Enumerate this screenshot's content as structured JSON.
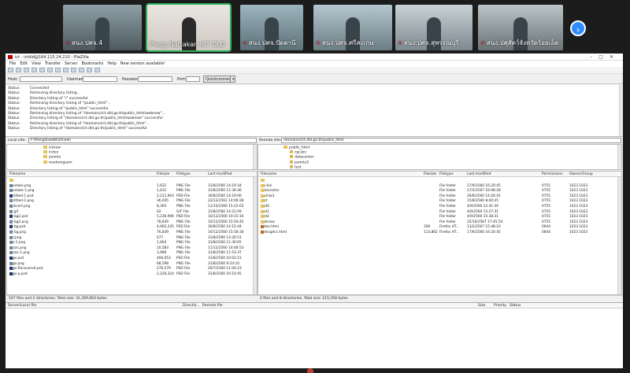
{
  "participants": [
    {
      "name": "สนง.ปศจ.4",
      "active": false
    },
    {
      "name": "Pleng Nattakan ICT DLD",
      "active": true
    },
    {
      "name": "สนง.ปศจ.ปัตตานี",
      "active": false
    },
    {
      "name": "สนง.ปศจ.ศรีสะเกษ",
      "active": false
    },
    {
      "name": "สนง.ปศจ.สุพรรณบุรี",
      "active": false
    },
    {
      "name": "สนง.ปศุสัตว์จังหวัดร้อยเอ็ด",
      "active": false
    }
  ],
  "next_icon": "chevron-right-icon",
  "window": {
    "title": "ict - ictdld@164.115.24.210 - FileZilla"
  },
  "menu": [
    "File",
    "Edit",
    "View",
    "Transfer",
    "Server",
    "Bookmarks",
    "Help",
    "New version available!"
  ],
  "quickconnect": {
    "host_label": "Host:",
    "username_label": "Username:",
    "password_label": "Password:",
    "port_label": "Port:",
    "button": "Quickconnect"
  },
  "status_lines": [
    {
      "k": "Status:",
      "v": "Connected"
    },
    {
      "k": "Status:",
      "v": "Retrieving directory listing..."
    },
    {
      "k": "Status:",
      "v": "Directory listing of \"/\" successful"
    },
    {
      "k": "Status:",
      "v": "Retrieving directory listing of \"/public_html\"..."
    },
    {
      "k": "Status:",
      "v": "Directory listing of \"/public_html\" successful"
    },
    {
      "k": "Status:",
      "v": "Retrieving directory listing of \"/domains/ict.dld.go.th/public_html/webnew\"..."
    },
    {
      "k": "Status:",
      "v": "Directory listing of \"/domains/ict.dld.go.th/public_html/webnew\" successful"
    },
    {
      "k": "Status:",
      "v": "Retrieving directory listing of \"/domains/ict.dld.go.th/public_html\"..."
    },
    {
      "k": "Status:",
      "v": "Directory listing of \"/domains/ict.dld.go.th/public_html\" successful"
    }
  ],
  "local": {
    "site_label": "Local site:",
    "path": "F:\\Pleng\\Ewebt\\ictnew\\",
    "tree": [
      "ictnew",
      "index",
      "joomla",
      "madrongsom"
    ],
    "headers": [
      "Filename",
      "Filesize",
      "Filetype",
      "Last modified"
    ],
    "files": [
      {
        "n": "..",
        "s": "",
        "t": "",
        "d": "",
        "i": "folder"
      },
      {
        "n": "youtube.png",
        "s": "1,631",
        "t": "PNG File",
        "d": "31/8/2560 14:10:34",
        "i": "png"
      },
      {
        "n": "youtube-1.png",
        "s": "1,631",
        "t": "PNG File",
        "d": "31/8/2560 11:36:46",
        "i": "png"
      },
      {
        "n": "Untitled-1.psd",
        "s": "2,211,903",
        "t": "PSD File",
        "d": "30/8/2560 14:19:06",
        "i": "psd"
      },
      {
        "n": "Untitled-1.png",
        "s": "36,045",
        "t": "PNG File",
        "d": "23/12/2561 14:06:28",
        "i": "png"
      },
      {
        "n": "thaicert.png",
        "s": "8,305",
        "t": "PNG File",
        "d": "11/10/2560 15:22:02",
        "i": "png"
      },
      {
        "n": "th.gif",
        "s": "62",
        "t": "GIF File",
        "d": "31/8/2560 14:21:09",
        "i": "png"
      },
      {
        "n": "t3-bg2.psd",
        "s": "5,236,996",
        "t": "PSD File",
        "d": "10/12/2560 10:15:16",
        "i": "psd"
      },
      {
        "n": "t3-bg2.png",
        "s": "78,839",
        "t": "PNG File",
        "d": "10/12/2560 15:56:45",
        "i": "png"
      },
      {
        "n": "t3-bg.psd",
        "s": "4,062,245",
        "t": "PSD File",
        "d": "30/8/2560 14:15:44",
        "i": "psd"
      },
      {
        "n": "t3-bg.png",
        "s": "76,839",
        "t": "PNG File",
        "d": "10/12/2560 15:58:30",
        "i": "png"
      },
      {
        "n": "ssl.png",
        "s": "677",
        "t": "PNG File",
        "d": "31/8/2560 13:26:51",
        "i": "png"
      },
      {
        "n": "rss-1.png",
        "s": "1,664",
        "t": "PNG File",
        "d": "31/8/2560 11:30:05",
        "i": "png"
      },
      {
        "n": "moac.png",
        "s": "10,583",
        "t": "PNG File",
        "d": "11/12/2560 14:48:53",
        "i": "png"
      },
      {
        "n": "moac-1.png",
        "s": "3,989",
        "t": "PNG File",
        "d": "31/8/2560 11:53:37",
        "i": "png"
      },
      {
        "n": "logo.psd",
        "s": "406,053",
        "t": "PSD File",
        "d": "31/8/2560 10:02:21",
        "i": "psd"
      },
      {
        "n": "logo.png",
        "s": "68,598",
        "t": "PNG File",
        "d": "31/8/2560 9:24:10",
        "i": "png"
      },
      {
        "n": "logo-Recovered.psd",
        "s": "276,579",
        "t": "PSD File",
        "d": "29/7/2560 11:04:23",
        "i": "psd"
      },
      {
        "n": "logo-p.psd",
        "s": "2,226,324",
        "t": "PSD File",
        "d": "31/8/2560 16:10:45",
        "i": "psd"
      }
    ],
    "summary": "107 files and 2 directories. Total size: 31,309,603 bytes"
  },
  "remote": {
    "site_label": "Remote site:",
    "path": "/domains/ict.dld.go.th/public_html",
    "tree": [
      "public_html",
      "cgi-bin",
      "datacenter",
      "joomla3",
      "test"
    ],
    "headers": [
      "Filename",
      "Filesize",
      "Filetype",
      "Last modified",
      "Permissions",
      "Owner/Group"
    ],
    "files": [
      {
        "n": "..",
        "s": "",
        "t": "",
        "d": "",
        "p": "",
        "o": "",
        "i": "folder"
      },
      {
        "n": "cgi-bin",
        "s": "",
        "t": "File folder",
        "d": "17/9/2560 16:20:45",
        "p": "0755",
        "o": "1023 1023",
        "i": "folder"
      },
      {
        "n": "datacenter",
        "s": "",
        "t": "File folder",
        "d": "27/2/2567 16:08:28",
        "p": "0755",
        "o": "1023 1023",
        "i": "folder"
      },
      {
        "n": "joomla3",
        "s": "",
        "t": "File folder",
        "d": "26/8/2560 14:26:41",
        "p": "0755",
        "o": "1023 1023",
        "i": "folder"
      },
      {
        "n": "test",
        "s": "",
        "t": "File folder",
        "d": "15/8/2560 8:00:25",
        "p": "0755",
        "o": "1023 1023",
        "i": "folder"
      },
      {
        "n": "test0",
        "s": "",
        "t": "File folder",
        "d": "4/9/2560 12:41:30",
        "p": "0755",
        "o": "1023 1023",
        "i": "folder"
      },
      {
        "n": "test1",
        "s": "",
        "t": "File folder",
        "d": "4/9/2560 15:27:31",
        "p": "0755",
        "o": "1023 1023",
        "i": "folder"
      },
      {
        "n": "test2",
        "s": "",
        "t": "File folder",
        "d": "4/9/2560 15:38:31",
        "p": "0755",
        "o": "1023 1023",
        "i": "folder"
      },
      {
        "n": "webnew",
        "s": "",
        "t": "File folder",
        "d": "25/10/2567 17:45:54",
        "p": "0755",
        "o": "1023 1023",
        "i": "folder"
      },
      {
        "n": "index.html",
        "s": "306",
        "t": "Firefox HT...",
        "d": "13/2/2567 15:48:10",
        "p": "0644",
        "o": "1023 1023",
        "i": "html"
      },
      {
        "n": "indexgdcc.html",
        "s": "114,862",
        "t": "Firefox HT...",
        "d": "17/6/2560 16:20:45",
        "p": "0644",
        "o": "1023 1023",
        "i": "html"
      }
    ],
    "summary": "2 files and 8 directories. Total size: 115,358 bytes"
  },
  "queue": {
    "headers": [
      "Server/Local file",
      "Directio...",
      "Remote file",
      "Size",
      "Priority",
      "Status"
    ]
  }
}
